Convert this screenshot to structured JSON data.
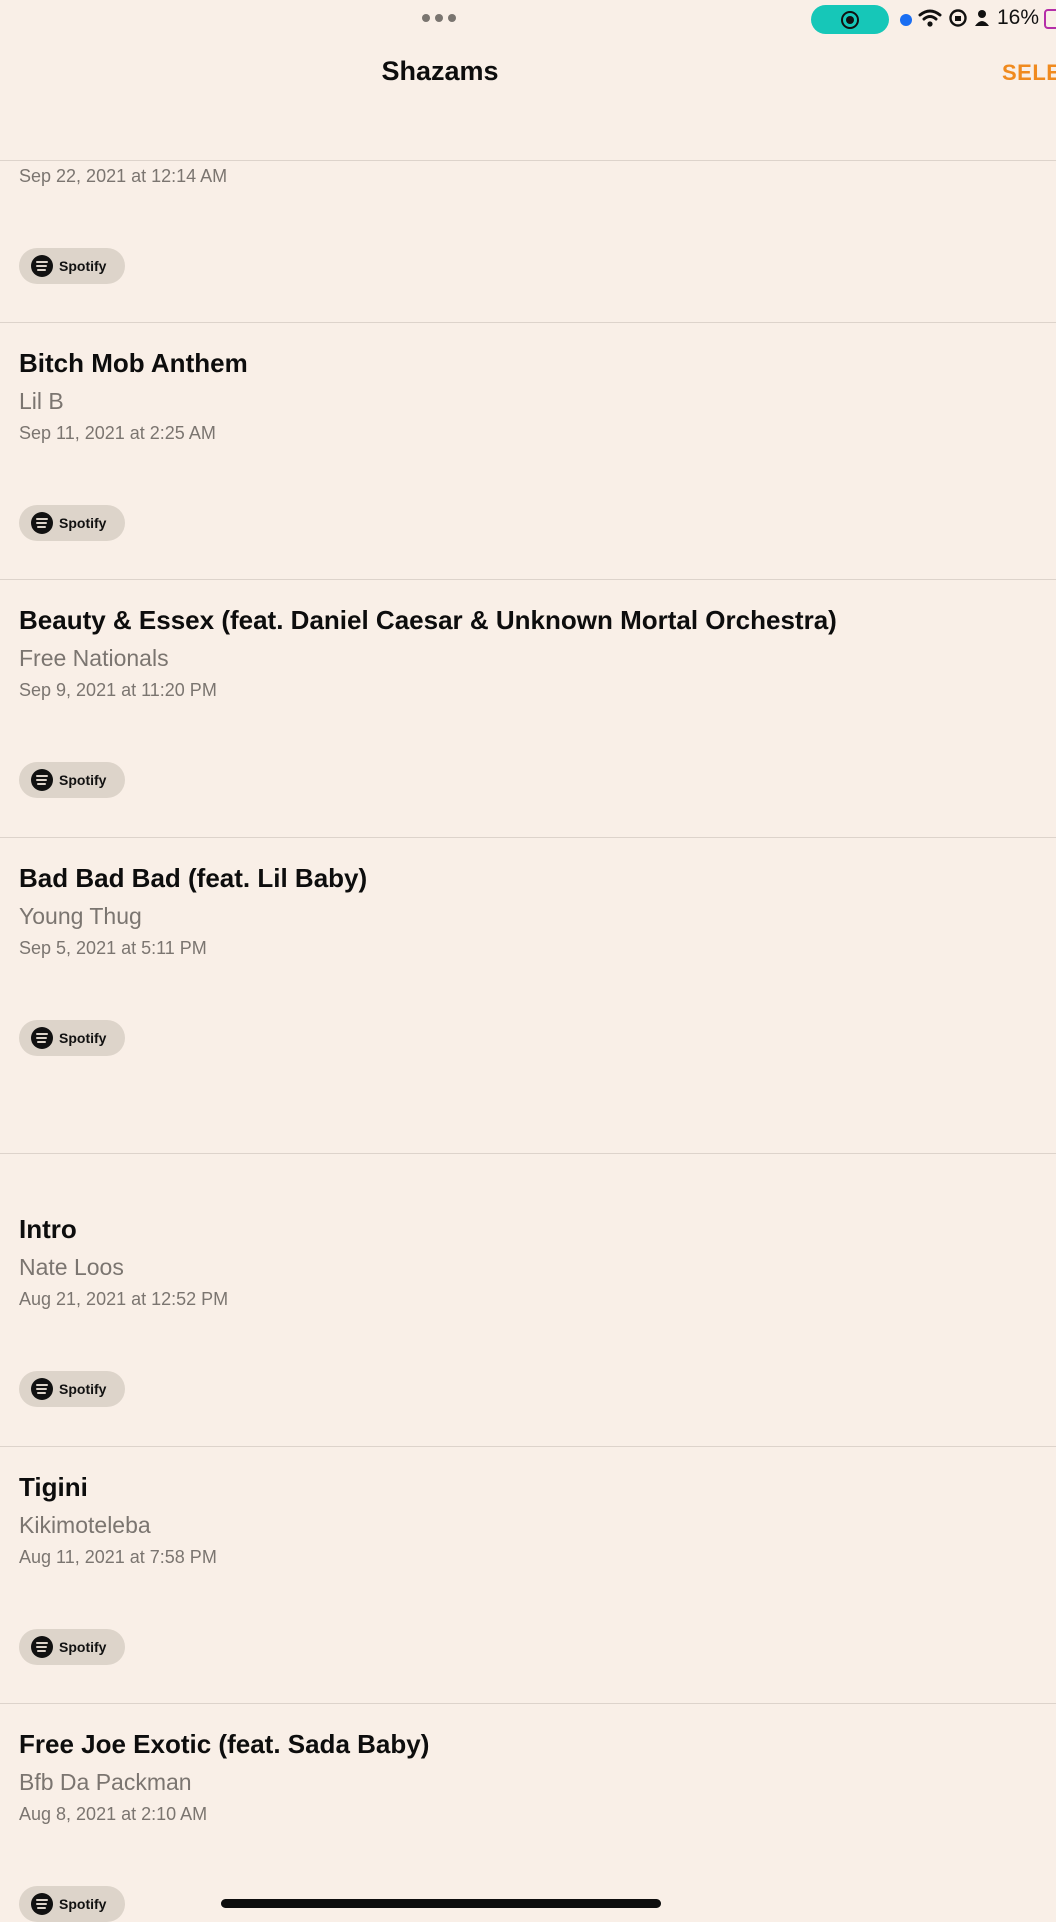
{
  "status_bar": {
    "battery_percent": "16%",
    "recording_active": true,
    "colors": {
      "recording": "#16c7b8",
      "dot": "#1a6ef2",
      "battery": "#b52ea8"
    }
  },
  "nav": {
    "title": "Shazams",
    "select_label": "SELE",
    "accent_color": "#f08a1e"
  },
  "top_item": {
    "date": "Sep 22, 2021 at 12:14 AM",
    "service": "Spotify"
  },
  "items": [
    {
      "title": "Bitch Mob Anthem",
      "artist": "Lil B",
      "date": "Sep 11, 2021 at 2:25 AM",
      "service": "Spotify"
    },
    {
      "title": "Beauty & Essex (feat. Daniel Caesar & Unknown Mortal Orchestra)",
      "artist": "Free Nationals",
      "date": "Sep 9, 2021 at 11:20 PM",
      "service": "Spotify"
    },
    {
      "title": "Bad Bad Bad (feat. Lil Baby)",
      "artist": "Young Thug",
      "date": "Sep 5, 2021 at 5:11 PM",
      "service": "Spotify"
    },
    {
      "title": "Intro",
      "artist": "Nate Loos",
      "date": "Aug 21, 2021 at 12:52 PM",
      "service": "Spotify"
    },
    {
      "title": "Tigini",
      "artist": "Kikimoteleba",
      "date": "Aug 11, 2021 at 7:58 PM",
      "service": "Spotify"
    },
    {
      "title": "Free Joe Exotic (feat. Sada Baby)",
      "artist": "Bfb Da Packman",
      "date": "Aug 8, 2021 at 2:10 AM",
      "service": "Spotify"
    }
  ]
}
